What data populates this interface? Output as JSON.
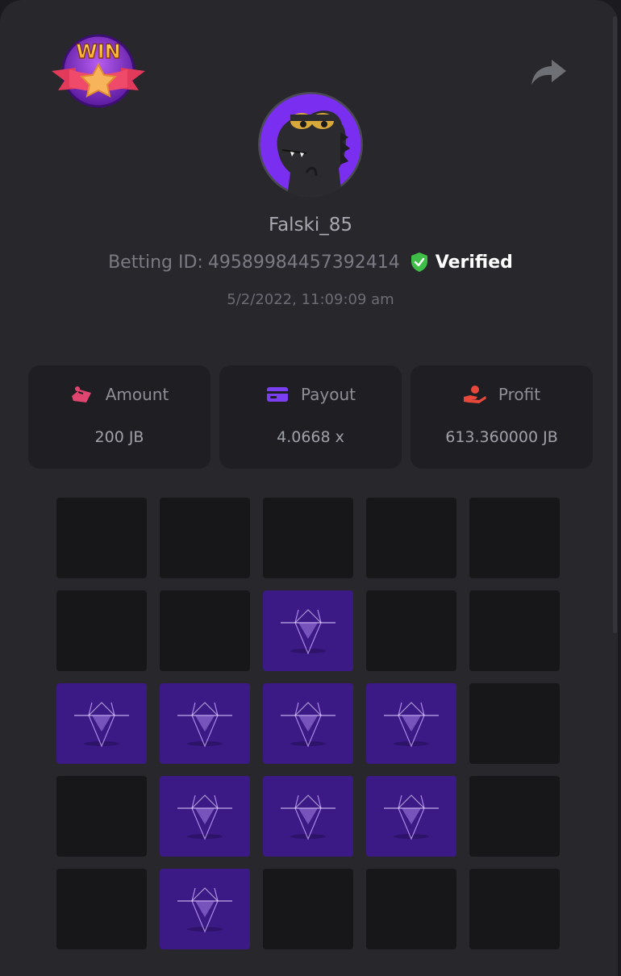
{
  "header": {
    "badge_text": "WIN",
    "share_icon": "share-arrow-icon"
  },
  "player": {
    "username": "Falski_85",
    "betting_label": "Betting ID:",
    "betting_id": "495899844573924‌14",
    "verified_label": "Verified",
    "timestamp": "5/2/2022, 11:09:09 am"
  },
  "stats": {
    "amount": {
      "label": "Amount",
      "value": "200 JB",
      "icon": "bet-chips-icon"
    },
    "payout": {
      "label": "Payout",
      "value": "4.0668 x",
      "icon": "card-icon"
    },
    "profit": {
      "label": "Profit",
      "value": "613.360000 JB",
      "icon": "hand-coin-icon"
    }
  },
  "board": {
    "rows": 5,
    "cols": 5,
    "cells": [
      [
        0,
        0,
        0,
        0,
        0
      ],
      [
        0,
        0,
        1,
        0,
        0
      ],
      [
        1,
        1,
        1,
        1,
        0
      ],
      [
        0,
        1,
        1,
        1,
        0
      ],
      [
        0,
        1,
        0,
        0,
        0
      ]
    ]
  },
  "colors": {
    "gem_tile": "#3b1a86",
    "empty_tile": "#17171a",
    "verified_green": "#3fbf48"
  }
}
